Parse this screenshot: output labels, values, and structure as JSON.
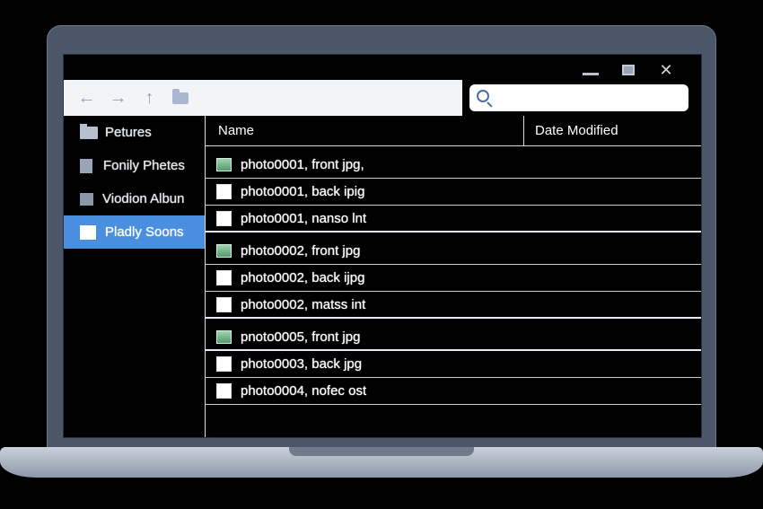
{
  "toolbar": {
    "icons": [
      "back-arrow-icon",
      "forward-arrow-icon",
      "up-arrow-icon",
      "folder-icon"
    ],
    "search_placeholder": ""
  },
  "sidebar": {
    "items": [
      {
        "label": "Petures",
        "icon": "folder-icon",
        "selected": false
      },
      {
        "label": "Fonily Phetes",
        "icon": "book-icon",
        "selected": false
      },
      {
        "label": "Viodion Albun",
        "icon": "album-icon",
        "selected": false
      },
      {
        "label": "Pladly Soons",
        "icon": "white-square-icon",
        "selected": true
      }
    ]
  },
  "list": {
    "columns": [
      "Name",
      "Date Modified"
    ],
    "rows": [
      {
        "name": "photo0001, front jpg,",
        "type": "image"
      },
      {
        "name": "photo0001, back ipig",
        "type": "doc"
      },
      {
        "name": "photo0001, nanso lnt",
        "type": "doc"
      },
      {
        "name": "photo0002, front jpg",
        "type": "image"
      },
      {
        "name": "photo0002, back ijpg",
        "type": "doc"
      },
      {
        "name": "photo0002, matss int",
        "type": "doc"
      },
      {
        "name": "pnoto0005, front jpg",
        "type": "image"
      },
      {
        "name": "photo0003, back jpg",
        "type": "doc"
      },
      {
        "name": "photo0004, nofec ost",
        "type": "doc"
      }
    ]
  },
  "colors": {
    "accent": "#4a8ee0",
    "bezel": "#4b5669",
    "toolbar_bg": "#f3f4f6",
    "nav_icon": "#8ea3c4"
  }
}
